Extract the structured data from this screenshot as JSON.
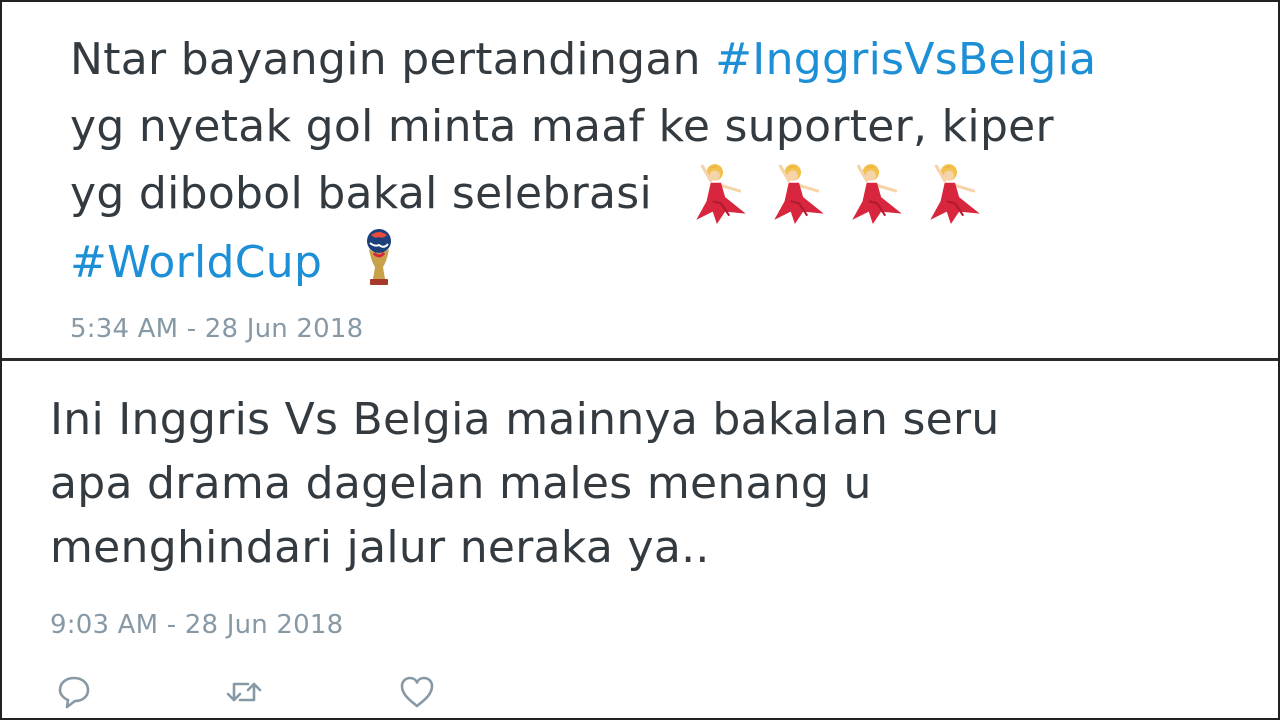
{
  "tweets": [
    {
      "lines": [
        {
          "text": "Ntar bayangin pertandingan ",
          "hashtag": "#InggrisVsBelgia"
        },
        {
          "text": "yg nyetak gol minta maaf ke suporter, kiper"
        },
        {
          "text": "yg dibobol bakal selebrasi"
        },
        {
          "hashtag": "#WorldCup"
        }
      ],
      "emoji": {
        "dancer": "dancing-woman-emoji",
        "trophy": "world-cup-trophy-emoji"
      },
      "timestamp": "5:34 AM - 28 Jun 2018"
    },
    {
      "lines": [
        {
          "text": "Ini Inggris Vs Belgia mainnya bakalan seru"
        },
        {
          "text": "apa drama dagelan males menang u"
        },
        {
          "text": "menghindari jalur neraka ya.."
        }
      ],
      "timestamp": "9:03 AM - 28 Jun 2018"
    }
  ],
  "actions": {
    "reply_icon": "reply-icon",
    "retweet_icon": "retweet-icon",
    "like_icon": "heart-icon"
  },
  "colors": {
    "hashtag": "#1d8fd6",
    "text": "#333a40",
    "timestamp": "#8899a6",
    "dancer_dress": "#d7263d",
    "dancer_hair": "#f2c14e"
  }
}
